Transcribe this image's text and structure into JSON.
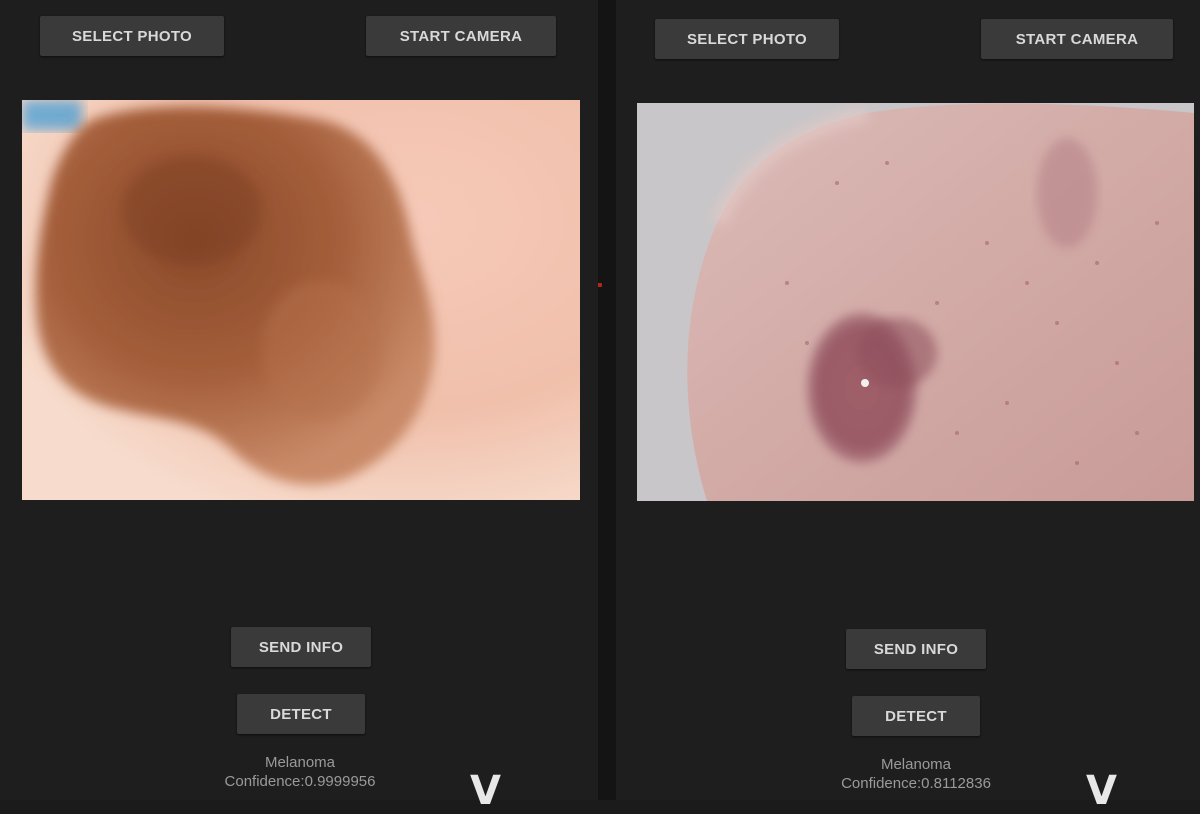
{
  "left": {
    "select_photo_label": "SELECT PHOTO",
    "start_camera_label": "START CAMERA",
    "send_info_label": "SEND INFO",
    "detect_label": "DETECT",
    "result_class": "Melanoma",
    "result_confidence": "Confidence:0.9999956"
  },
  "right": {
    "select_photo_label": "SELECT PHOTO",
    "start_camera_label": "START CAMERA",
    "send_info_label": "SEND INFO",
    "detect_label": "DETECT",
    "result_class": "Melanoma",
    "result_confidence": "Confidence:0.8112836"
  },
  "watermark": {
    "text": "V",
    "logo": "partially cut-off white logo watermark"
  },
  "colors": {
    "background": "#1e1e1e",
    "button": "#3a3a3a",
    "button_text": "#d9d9d9",
    "result_text": "#9a9a9a"
  }
}
